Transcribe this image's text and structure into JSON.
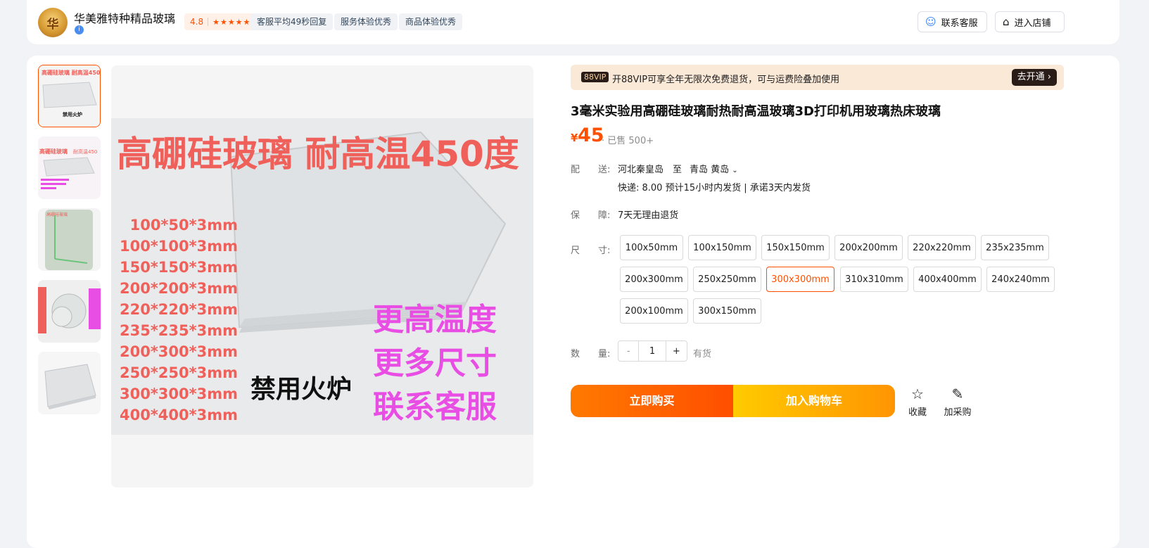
{
  "shop": {
    "logo_text": "华",
    "name": "华美雅特种精品玻璃",
    "verify_icon": "i",
    "rating": "4.8",
    "stars": "★★★★★",
    "tags": [
      "客服平均49秒回复",
      "服务体验优秀",
      "商品体验优秀"
    ],
    "contact_label": "联系客服",
    "enter_label": "进入店铺"
  },
  "gallery": {
    "main_image": {
      "headline": "高硼硅玻璃 耐高温450度",
      "sizes_list": [
        "100*50*3mm",
        "100*100*3mm",
        "150*150*3mm",
        "200*200*3mm",
        "220*220*3mm",
        "235*235*3mm",
        "200*300*3mm",
        "250*250*3mm",
        "300*300*3mm",
        "400*400*3mm"
      ],
      "warning": "禁用火炉",
      "promo": [
        "更高温度",
        "更多尺寸",
        "联系客服"
      ]
    },
    "thumbs": [
      {
        "headline": "高硼硅玻璃 耐高温450度",
        "caption": "禁用火炉"
      },
      {
        "headline": "高硼硅玻璃",
        "note": "耐高温450"
      },
      {
        "headline": "高硼硅玻璃"
      },
      {
        "headline": "高硼硅玻璃",
        "note": "形状尺寸厚度支持定制"
      },
      {}
    ]
  },
  "vip_banner": {
    "badge": "88VIP",
    "text": "开88VIP可享全年无限次免费退货，可与运费险叠加使用",
    "button": "去开通 ›"
  },
  "product": {
    "title": "3毫米实验用高硼硅玻璃耐热耐高温玻璃3D打印机用玻璃热床玻璃",
    "price_symbol": "¥",
    "price": "45",
    "sold": "· 已售 500+"
  },
  "delivery": {
    "label": "配　　送:",
    "from": "河北秦皇岛",
    "to_word": "至",
    "to": "青岛 黄岛",
    "detail": "快递: 8.00   预计15小时内发货 | 承诺3天内发货"
  },
  "guarantee": {
    "label": "保　　障:",
    "value": "7天无理由退货"
  },
  "sizes": {
    "label": "尺　　寸:",
    "options": [
      "100x50mm",
      "100x150mm",
      "150x150mm",
      "200x200mm",
      "220x220mm",
      "235x235mm",
      "200x300mm",
      "250x250mm",
      "300x300mm",
      "310x310mm",
      "400x400mm",
      "240x240mm",
      "200x100mm",
      "300x150mm"
    ],
    "selected": "300x300mm"
  },
  "quantity": {
    "label": "数　　量:",
    "minus": "-",
    "value": "1",
    "plus": "+",
    "stock": "有货"
  },
  "actions": {
    "buy": "立即购买",
    "cart": "加入购物车",
    "favorite": "收藏",
    "purchase_list": "加采购"
  },
  "colors": {
    "accent": "#ff5000",
    "promo_magenta": "#e94ee4",
    "headline_red": "#f0605a"
  }
}
